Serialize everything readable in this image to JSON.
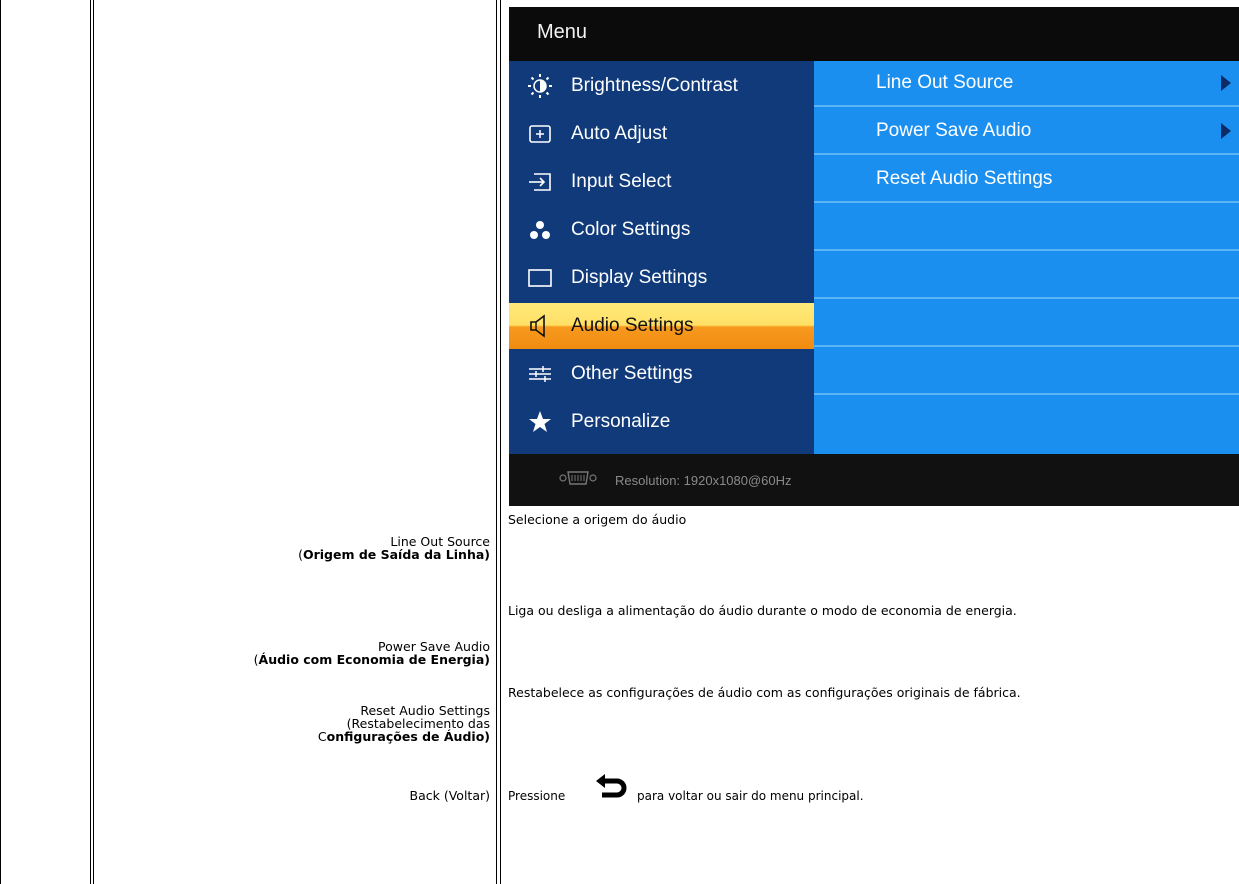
{
  "osd": {
    "menu_title": "Menu",
    "menu_items": [
      {
        "label": "Brightness/Contrast",
        "icon": "brightness-icon"
      },
      {
        "label": "Auto Adjust",
        "icon": "auto-adjust-icon"
      },
      {
        "label": "Input Select",
        "icon": "input-select-icon"
      },
      {
        "label": "Color Settings",
        "icon": "color-settings-icon"
      },
      {
        "label": "Display Settings",
        "icon": "display-settings-icon"
      },
      {
        "label": "Audio Settings",
        "icon": "speaker-icon"
      },
      {
        "label": "Other Settings",
        "icon": "sliders-icon"
      },
      {
        "label": "Personalize",
        "icon": "star-icon"
      }
    ],
    "selected_item": "Audio Settings",
    "submenu": [
      {
        "label": "Line Out Source",
        "has_arrow": true
      },
      {
        "label": "Power Save Audio",
        "has_arrow": true
      },
      {
        "label": "Reset Audio Settings",
        "has_arrow": false
      },
      {
        "label": "",
        "has_arrow": false
      },
      {
        "label": "",
        "has_arrow": false
      },
      {
        "label": "",
        "has_arrow": false
      },
      {
        "label": "",
        "has_arrow": false
      },
      {
        "label": "",
        "has_arrow": false
      }
    ],
    "resolution": "Resolution:  1920x1080@60Hz",
    "colors": {
      "left_panel": "#103a7a",
      "right_panel": "#1a8ff0",
      "selected_top": "#ffe066",
      "selected_bottom": "#f08c10"
    }
  },
  "doc": {
    "line_out": {
      "name": "Line Out Source",
      "translation_open": "(",
      "translation": "Origem de Saída da Linha)",
      "desc": "Selecione a origem do áudio"
    },
    "power_save": {
      "name": "Power Save Audio",
      "translation_open": "(",
      "translation": "Áudio com Economia de Energia)",
      "desc": "Liga ou desliga a alimentação do áudio durante o modo de economia de energia."
    },
    "reset": {
      "name": "Reset Audio Settings",
      "line2": "(Restabelecimento das",
      "line3_prefix": "C",
      "line3_bold": "onfigurações de Áudio)",
      "desc": "Restabelece as configurações de áudio com as configurações originais de fábrica."
    },
    "back": {
      "name": "Back (Voltar)",
      "desc_before": "Pressione",
      "desc_after": "para voltar ou sair do menu principal.",
      "icon": "back-arrow-icon"
    }
  }
}
